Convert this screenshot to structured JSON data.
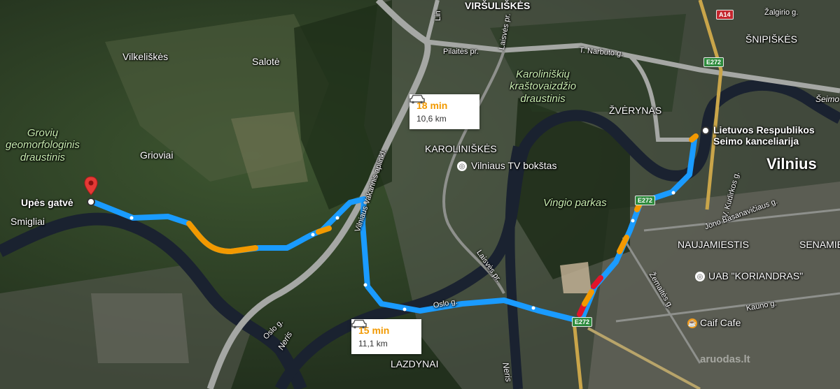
{
  "place_labels": {
    "virsuliskes": "VIRŠULIŠKĖS",
    "vilkeliskes": "Vilkeliškės",
    "salote": "Salotė",
    "groviu": "Grovių\ngeomorfologinis\ndraustinis",
    "grioviai": "Grioviai",
    "smigliai": "Smigliai",
    "karoliniskiu_park": "Karoliniškių\nkraštovaizdžio\ndraustinis",
    "zverynas": "ŽVĖRYNAS",
    "karoliniskes": "KAROLINIŠKĖS",
    "vingio": "Vingio parkas",
    "naujamiestis": "NAUJAMIESTIS",
    "senamiestis": "SENAMIE",
    "snipiskes": "ŠNIPIŠKĖS",
    "vilnius": "Vilnius",
    "lazdynai": "LAZDYNAI",
    "seimas_partial": "Šeimo",
    "neris1": "Neris",
    "neris2": "Neris"
  },
  "street_labels": {
    "pilaites": "Pilaitės pr.",
    "narbuto": "T. Narbuto g.",
    "laisves1": "Laisvės pr.",
    "laisves2": "Laisvės pr.",
    "vakarinis": "Vilniaus Vakarinis aplinkl.",
    "oslo1": "Oslo g.",
    "oslo2": "Oslo g.",
    "zemaites": "Žemaitės g.",
    "kauno": "Kauno g.",
    "basanaviciaus": "Jono Basanavičiaus g.",
    "kudirkos": "V. Kudirkos g.",
    "zalgirio": "Žalgirio g.",
    "lin": "Lin"
  },
  "route_shields": {
    "a14": "A14",
    "e272_a": "E272",
    "e272_b": "E272",
    "e272_c": "E272"
  },
  "poi": {
    "origin": "Upės gatvė",
    "destination": "Lietuvos Respublikos\nSeimo kanceliarija",
    "tv_tower": "Vilniaus TV bokštas",
    "koriandras": "UAB \"KORIANDRAS\"",
    "caif": "Caif Cafe"
  },
  "route_cards": [
    {
      "time": "18 min",
      "distance": "10,6 km"
    },
    {
      "time": "15 min",
      "distance": "11,1 km"
    }
  ],
  "watermark": "aruodas.lt",
  "colors": {
    "route_primary": "#1a9bff",
    "traffic_slow": "#f29900",
    "traffic_heavy": "#e0142a",
    "route_alt": "#9aa0a6",
    "pin": "#e53935"
  }
}
